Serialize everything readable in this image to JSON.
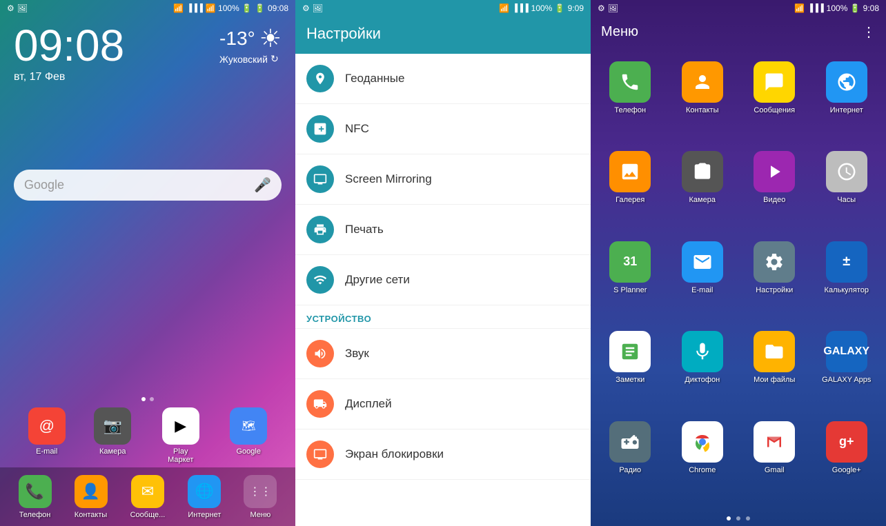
{
  "home": {
    "time": "09:08",
    "date": "вт, 17 Фев",
    "weather_temp": "-13°",
    "weather_location": "Жуковский",
    "search_placeholder": "Google",
    "status_icons": "📶 100% 🔋",
    "clock_label": "9:08",
    "dock_apps": [
      {
        "label": "E-mail",
        "color": "#f44336",
        "icon": "@"
      },
      {
        "label": "Камера",
        "color": "#555",
        "icon": "📷"
      },
      {
        "label": "Play Маркет",
        "color": "#f5f5f5",
        "icon": "▶"
      },
      {
        "label": "Google",
        "color": "#4caf50",
        "icon": "G"
      }
    ],
    "bottom_apps": [
      {
        "label": "Телефон",
        "color": "#4caf50",
        "icon": "📞"
      },
      {
        "label": "Контакты",
        "color": "#ff9800",
        "icon": "👤"
      },
      {
        "label": "Сообще...",
        "color": "#ffc107",
        "icon": "✉"
      },
      {
        "label": "Интернет",
        "color": "#2196f3",
        "icon": "🌐"
      },
      {
        "label": "Меню",
        "color": "#555",
        "icon": "⋮⋮⋮"
      }
    ]
  },
  "settings": {
    "title": "Настройки",
    "time": "9:09",
    "items": [
      {
        "icon": "📍",
        "label": "Геоданные",
        "color": "#2196a8"
      },
      {
        "icon": "📡",
        "label": "NFC",
        "color": "#2196a8"
      },
      {
        "icon": "📺",
        "label": "Screen Mirroring",
        "color": "#2196a8"
      },
      {
        "icon": "🖨",
        "label": "Печать",
        "color": "#2196a8"
      },
      {
        "icon": "📶",
        "label": "Другие сети",
        "color": "#2196a8"
      }
    ],
    "section_device": "УСТРОЙСТВО",
    "device_items": [
      {
        "icon": "🔊",
        "label": "Звук",
        "color": "#ff7043"
      },
      {
        "icon": "💡",
        "label": "Дисплей",
        "color": "#ff7043"
      },
      {
        "icon": "🔒",
        "label": "Экран блокировки",
        "color": "#ff7043"
      }
    ]
  },
  "menu": {
    "title": "Меню",
    "time": "9:08",
    "apps": [
      {
        "label": "Телефон",
        "color": "#4caf50",
        "icon": "📞"
      },
      {
        "label": "Контакты",
        "color": "#ff9800",
        "icon": "👤"
      },
      {
        "label": "Сообщения",
        "color": "#ffd600",
        "icon": "✉"
      },
      {
        "label": "Интернет",
        "color": "#2196f3",
        "icon": "🌐"
      },
      {
        "label": "Галерея",
        "color": "#ff8f00",
        "icon": "🖼"
      },
      {
        "label": "Камера",
        "color": "#555",
        "icon": "📷"
      },
      {
        "label": "Видео",
        "color": "#9c27b0",
        "icon": "▶"
      },
      {
        "label": "Часы",
        "color": "#bdbdbd",
        "icon": "🕐"
      },
      {
        "label": "S Planner",
        "color": "#4caf50",
        "icon": "31"
      },
      {
        "label": "E-mail",
        "color": "#2196f3",
        "icon": "@"
      },
      {
        "label": "Настройки",
        "color": "#607d8b",
        "icon": "⚙"
      },
      {
        "label": "Калькулятор",
        "color": "#1565c0",
        "icon": "±"
      },
      {
        "label": "Заметки",
        "color": "#fff",
        "icon": "📝"
      },
      {
        "label": "Диктофон",
        "color": "#00acc1",
        "icon": "🎤"
      },
      {
        "label": "Мои файлы",
        "color": "#ffb300",
        "icon": "📁"
      },
      {
        "label": "GALAXY Apps",
        "color": "#1565c0",
        "icon": "G"
      },
      {
        "label": "Радио",
        "color": "#546e7a",
        "icon": "📻"
      },
      {
        "label": "Chrome",
        "color": "#fff",
        "icon": "C"
      },
      {
        "label": "Gmail",
        "color": "#fff",
        "icon": "M"
      },
      {
        "label": "Google+",
        "color": "#e53935",
        "icon": "g+"
      }
    ],
    "page_dots": 3,
    "active_dot": 0
  }
}
